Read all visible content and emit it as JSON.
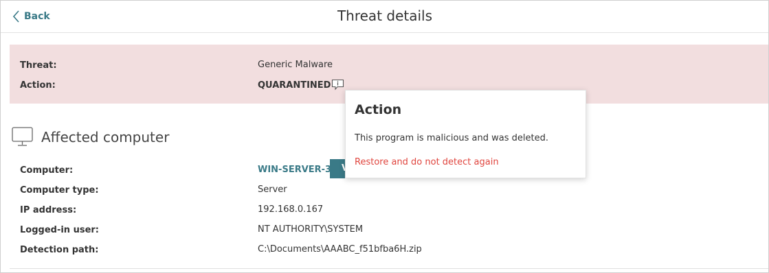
{
  "header": {
    "back_label": "Back",
    "title": "Threat details"
  },
  "threat": {
    "threat_label": "Threat:",
    "threat_value": "Generic Malware",
    "action_label": "Action:",
    "action_value": "QUARANTINED"
  },
  "affected": {
    "section_title": "Affected computer",
    "computer_label": "Computer:",
    "computer_value": "WIN-SERVER-3",
    "view_button_label": "V",
    "computer_type_label": "Computer type:",
    "computer_type_value": "Server",
    "ip_label": "IP address:",
    "ip_value": "192.168.0.167",
    "user_label": "Logged-in user:",
    "user_value": "NT AUTHORITY\\SYSTEM",
    "path_label": "Detection path:",
    "path_value": "C:\\Documents\\AAABC_f51bfba6H.zip"
  },
  "popover": {
    "title": "Action",
    "text": "This program is malicious and was deleted.",
    "link": "Restore and do not detect again"
  },
  "colors": {
    "accent": "#3a7a87",
    "threat_panel_bg": "#f2dedf",
    "danger_link": "#e0453e"
  },
  "icons": {
    "back": "chevron-left-icon",
    "info": "info-comment-icon",
    "computer": "monitor-icon"
  }
}
